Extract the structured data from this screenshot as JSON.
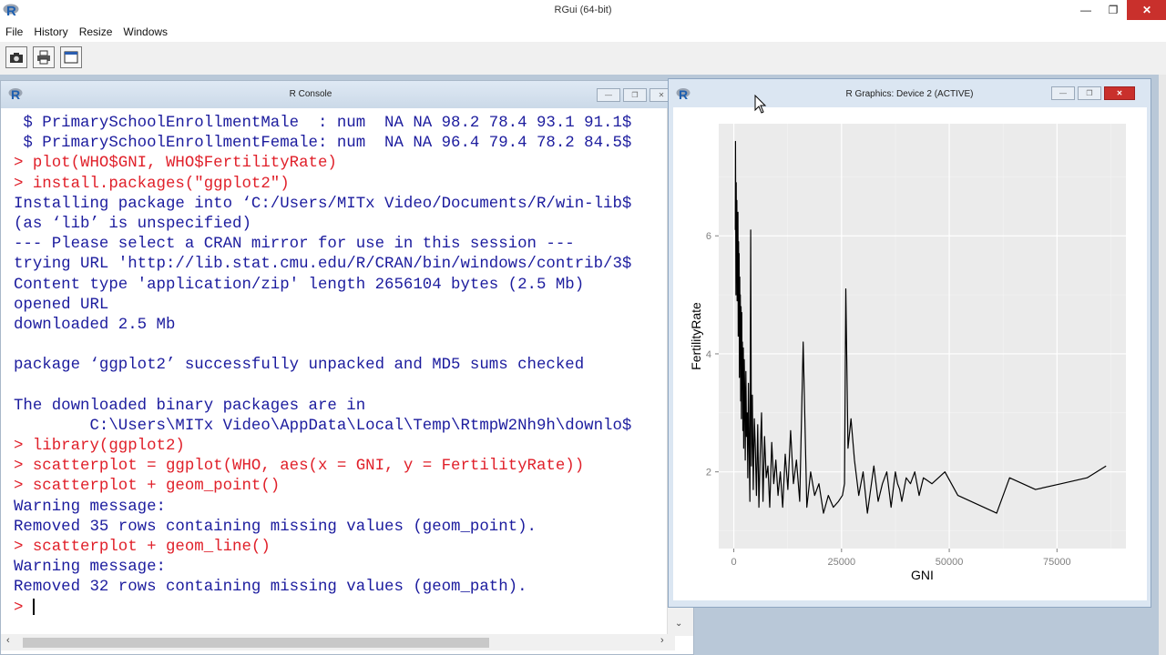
{
  "app": {
    "title": "RGui (64-bit)",
    "menu": [
      "File",
      "History",
      "Resize",
      "Windows"
    ]
  },
  "console": {
    "title": "R Console",
    "lines": [
      {
        "t": " $ PrimarySchoolEnrollmentMale  : num  NA NA 98.2 78.4 93.1 91.1$",
        "c": "out"
      },
      {
        "t": " $ PrimarySchoolEnrollmentFemale: num  NA NA 96.4 79.4 78.2 84.5$",
        "c": "out"
      },
      {
        "t": "> plot(WHO$GNI, WHO$FertilityRate)",
        "c": "in"
      },
      {
        "t": "> install.packages(\"ggplot2\")",
        "c": "in"
      },
      {
        "t": "Installing package into ‘C:/Users/MITx Video/Documents/R/win-lib$",
        "c": "out"
      },
      {
        "t": "(as ‘lib’ is unspecified)",
        "c": "out"
      },
      {
        "t": "--- Please select a CRAN mirror for use in this session ---",
        "c": "out"
      },
      {
        "t": "trying URL 'http://lib.stat.cmu.edu/R/CRAN/bin/windows/contrib/3$",
        "c": "out"
      },
      {
        "t": "Content type 'application/zip' length 2656104 bytes (2.5 Mb)",
        "c": "out"
      },
      {
        "t": "opened URL",
        "c": "out"
      },
      {
        "t": "downloaded 2.5 Mb",
        "c": "out"
      },
      {
        "t": "",
        "c": "out"
      },
      {
        "t": "package ‘ggplot2’ successfully unpacked and MD5 sums checked",
        "c": "out"
      },
      {
        "t": "",
        "c": "out"
      },
      {
        "t": "The downloaded binary packages are in",
        "c": "out"
      },
      {
        "t": "        C:\\Users\\MITx Video\\AppData\\Local\\Temp\\RtmpW2Nh9h\\downlo$",
        "c": "out"
      },
      {
        "t": "> library(ggplot2)",
        "c": "in"
      },
      {
        "t": "> scatterplot = ggplot(WHO, aes(x = GNI, y = FertilityRate))",
        "c": "in"
      },
      {
        "t": "> scatterplot + geom_point()",
        "c": "in"
      },
      {
        "t": "Warning message:",
        "c": "out"
      },
      {
        "t": "Removed 35 rows containing missing values (geom_point).",
        "c": "out"
      },
      {
        "t": "> scatterplot + geom_line()",
        "c": "in"
      },
      {
        "t": "Warning message:",
        "c": "out"
      },
      {
        "t": "Removed 32 rows containing missing values (geom_path).",
        "c": "out"
      }
    ],
    "prompt": "> "
  },
  "graphics": {
    "title": "R Graphics: Device 2 (ACTIVE)"
  },
  "chart_data": {
    "type": "line",
    "xlabel": "GNI",
    "ylabel": "FertilityRate",
    "xlim": [
      -3500,
      91000
    ],
    "ylim": [
      0.7,
      7.9
    ],
    "xticks": [
      0,
      25000,
      50000,
      75000
    ],
    "xtick_labels": [
      "0",
      "25000",
      "50000",
      "75000"
    ],
    "yticks": [
      2,
      4,
      6
    ],
    "ytick_labels": [
      "2",
      "4",
      "6"
    ],
    "grid": true,
    "background": "#ebebeb",
    "line_color": "#000000",
    "series": [
      {
        "x": [
          340,
          400,
          500,
          560,
          620,
          700,
          760,
          820,
          900,
          960,
          1020,
          1100,
          1160,
          1230,
          1300,
          1380,
          1440,
          1520,
          1600,
          1680,
          1760,
          1840,
          1920,
          2000,
          2100,
          2200,
          2300,
          2420,
          2540,
          2660,
          2800,
          2950,
          3100,
          3250,
          3400,
          3560,
          3740,
          3920,
          4100,
          4300,
          4520,
          4760,
          5000,
          5260,
          5540,
          5820,
          6120,
          6440,
          6780,
          7140,
          7520,
          7920,
          8340,
          8800,
          9260,
          9760,
          10260,
          10800,
          11340,
          11940,
          12540,
          13180,
          13840,
          14540,
          15300,
          16100,
          16940,
          17840,
          18760,
          19760,
          20820,
          21940,
          23100,
          24300,
          25200,
          25700,
          26000,
          26500,
          27200,
          28000,
          29000,
          30000,
          31000,
          32500,
          33500,
          34500,
          35500,
          36500,
          37500,
          38000,
          38500,
          39000,
          40000,
          41000,
          42000,
          43000,
          44000,
          46000,
          49000,
          52000,
          58000,
          61000,
          64000,
          70000,
          76000,
          82000,
          86400
        ],
        "y": [
          6.1,
          7.6,
          5.0,
          6.9,
          5.4,
          6.6,
          4.9,
          6.2,
          5.1,
          6.4,
          4.3,
          5.9,
          4.5,
          5.7,
          3.6,
          5.3,
          3.9,
          5.0,
          3.2,
          4.8,
          2.9,
          4.7,
          3.4,
          4.2,
          2.7,
          4.1,
          2.4,
          3.9,
          3.3,
          2.2,
          3.7,
          2.6,
          3.0,
          1.9,
          3.5,
          2.4,
          1.5,
          6.1,
          2.1,
          3.3,
          1.7,
          2.9,
          2.4,
          1.6,
          2.8,
          1.4,
          2.3,
          3.0,
          1.5,
          2.6,
          1.9,
          2.1,
          1.4,
          2.5,
          1.8,
          2.2,
          1.6,
          2.0,
          1.4,
          2.3,
          1.7,
          2.7,
          1.8,
          2.2,
          1.5,
          4.2,
          1.4,
          2.0,
          1.6,
          1.8,
          1.3,
          1.6,
          1.4,
          1.5,
          1.6,
          1.8,
          5.1,
          2.4,
          2.9,
          2.2,
          1.6,
          2.0,
          1.3,
          2.1,
          1.5,
          1.8,
          2.0,
          1.4,
          2.0,
          1.8,
          1.7,
          1.5,
          1.9,
          1.8,
          2.0,
          1.6,
          1.9,
          1.8,
          2.0,
          1.6,
          1.4,
          1.3,
          1.9,
          1.7,
          1.8,
          1.9,
          2.1
        ]
      }
    ]
  }
}
